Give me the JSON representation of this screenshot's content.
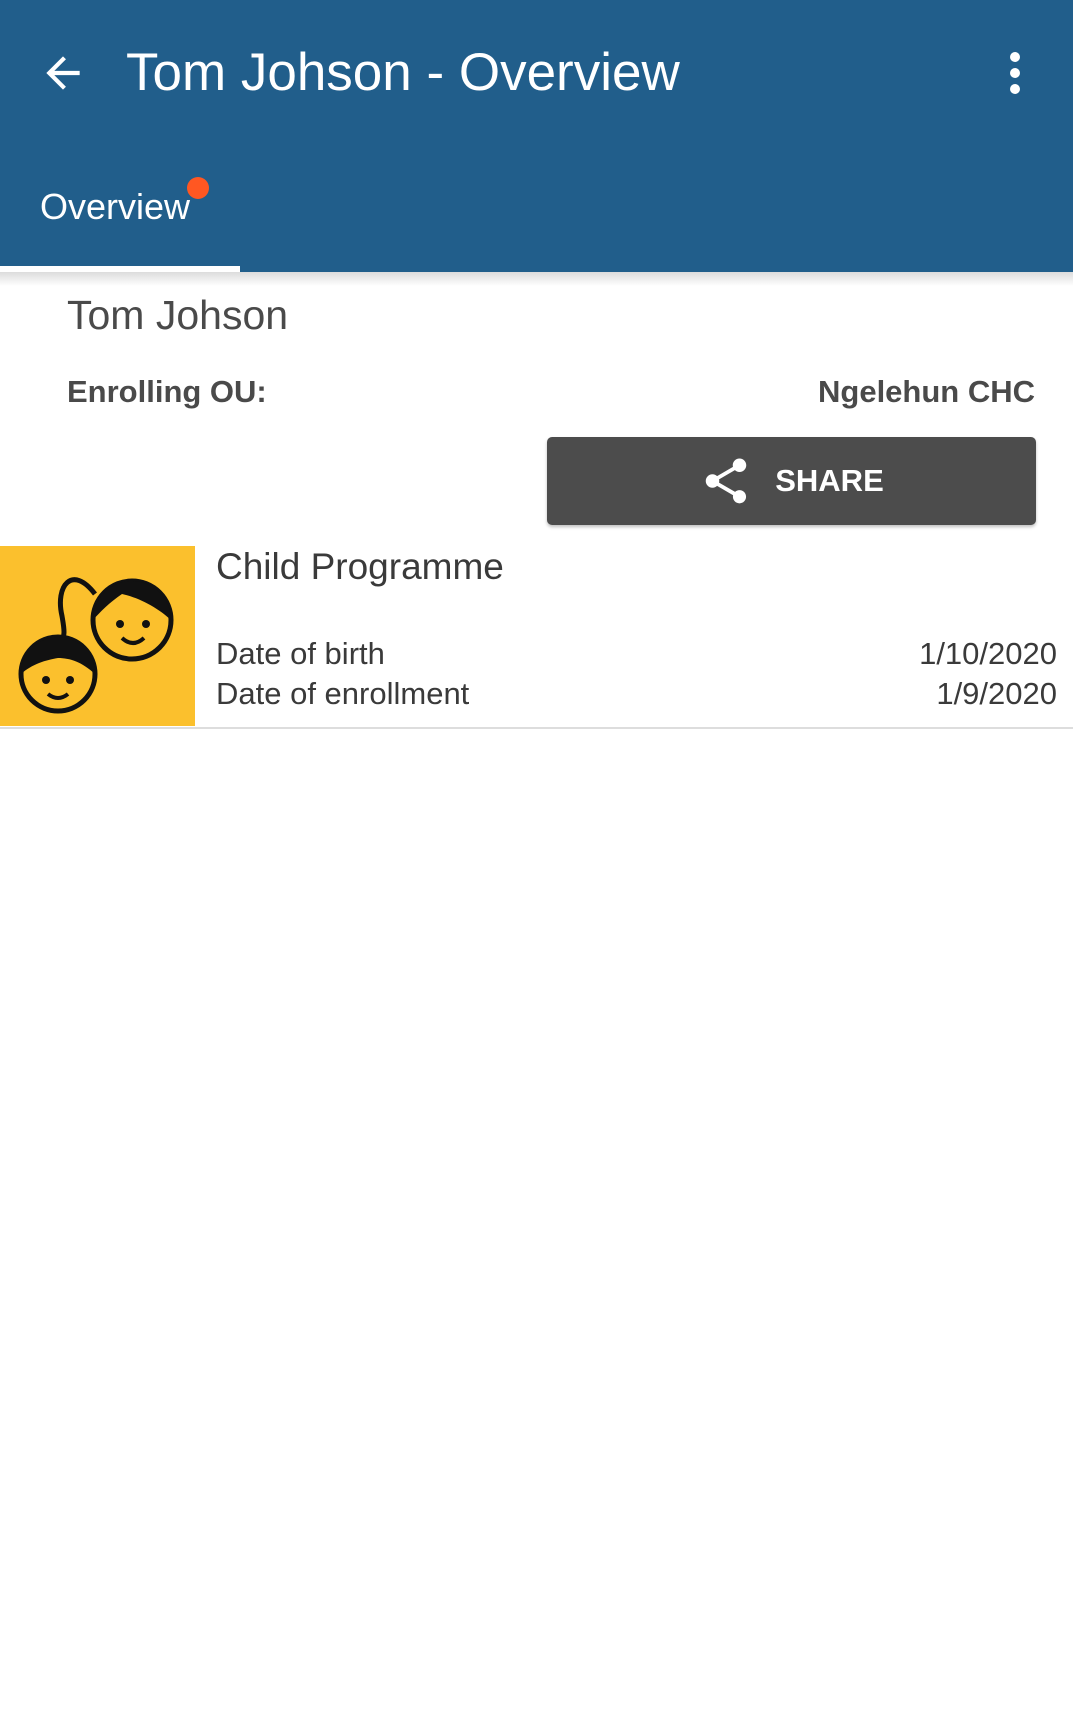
{
  "header": {
    "title": "Tom Johson - Overview",
    "back_icon": "arrow-left-icon",
    "more_icon": "more-vertical-icon",
    "background_color": "#215E8B"
  },
  "tabs": [
    {
      "label": "Overview",
      "selected": true,
      "has_badge": true,
      "badge_color": "#FF5722"
    }
  ],
  "profile": {
    "name": "Tom Johson",
    "enrolling_ou_label": "Enrolling OU:",
    "enrolling_ou_value": "Ngelehun CHC"
  },
  "share_button": {
    "label": "SHARE",
    "icon": "share-icon"
  },
  "program": {
    "name": "Child Programme",
    "icon": "children-faces-icon",
    "icon_bg_color": "#FBC02D",
    "rows": [
      {
        "label": "Date of birth",
        "value": "1/10/2020"
      },
      {
        "label": "Date of enrollment",
        "value": "1/9/2020"
      }
    ]
  }
}
